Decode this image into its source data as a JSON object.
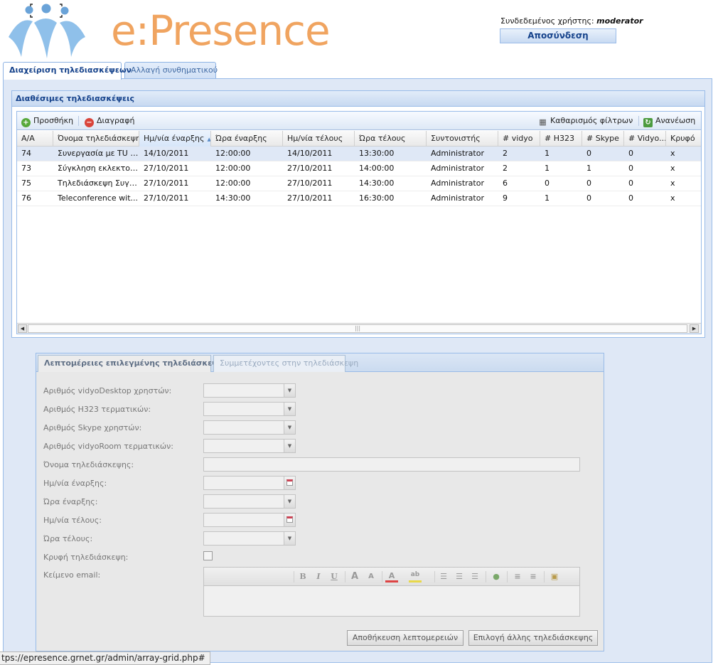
{
  "header": {
    "logo_text": "e:Presence",
    "user_label": "Συνδεδεμένος χρήστης:",
    "username": "moderator",
    "logout_label": "Αποσύνδεση"
  },
  "top_tabs": [
    {
      "label": "Διαχείριση τηλεδιασκέψεων",
      "active": true
    },
    {
      "label": "Αλλαγή συνθηματικού",
      "active": false
    }
  ],
  "grid": {
    "title": "Διαθέσιμες τηλεδιασκέψεις",
    "toolbar": {
      "add_label": "Προσθήκη",
      "delete_label": "Διαγραφή",
      "clear_filters_label": "Καθαρισμός φίλτρων",
      "refresh_label": "Ανανέωση"
    },
    "columns": [
      "Α/Α",
      "Όνομα τηλεδιάσκεψης",
      "Ημ/νία έναρξης",
      "Ώρα έναρξης",
      "Ημ/νία τέλους",
      "Ώρα τέλους",
      "Συντονιστής",
      "# vidyo",
      "# H323",
      "# Skype",
      "# Vidyo...",
      "Κρυφό"
    ],
    "sorted_column": "Ημ/νία έναρξης",
    "rows": [
      [
        "74",
        "Συνεργασία με TU B...",
        "14/10/2011",
        "12:00:00",
        "14/10/2011",
        "13:30:00",
        "Administrator",
        "2",
        "1",
        "0",
        "0",
        "x"
      ],
      [
        "73",
        "Σύγκληση εκλεκτορι...",
        "27/10/2011",
        "12:00:00",
        "27/10/2011",
        "14:00:00",
        "Administrator",
        "2",
        "1",
        "1",
        "0",
        "x"
      ],
      [
        "75",
        "Τηλεδιάσκεψη Συγκ...",
        "27/10/2011",
        "12:00:00",
        "27/10/2011",
        "14:30:00",
        "Administrator",
        "6",
        "0",
        "0",
        "0",
        "x"
      ],
      [
        "76",
        "Teleconference wit...",
        "27/10/2011",
        "14:30:00",
        "27/10/2011",
        "16:30:00",
        "Administrator",
        "9",
        "1",
        "0",
        "0",
        "x"
      ]
    ],
    "selected_row": 0
  },
  "details": {
    "tabs": [
      {
        "label": "Λεπτομέρειες επιλεγμένης τηλεδιάσκεψης",
        "active": true
      },
      {
        "label": "Συμμετέχοντες στην τηλεδιάσκεψη",
        "active": false
      }
    ],
    "fields": {
      "vidyo_desktop": "Αριθμός vidyoDesktop χρηστών:",
      "h323": "Αριθμός H323 τερματικών:",
      "skype": "Αριθμός Skype χρηστών:",
      "vidyo_room": "Αριθμός vidyoRoom τερματικών:",
      "name": "Όνομα τηλεδιάσκεψης:",
      "start_date": "Ημ/νία έναρξης:",
      "start_time": "Ώρα έναρξης:",
      "end_date": "Ημ/νία τέλους:",
      "end_time": "Ώρα τέλους:",
      "hidden": "Κρυφή τηλεδιάσκεψη:",
      "email_text": "Κείμενο email:"
    },
    "editor_buttons": {
      "bold": "B",
      "italic": "I",
      "underline": "U",
      "grow": "A",
      "shrink": "A",
      "color": "A",
      "highlight": "ab"
    },
    "save_label": "Αποθήκευση λεπτομερειών",
    "select_other_label": "Επιλογή άλλης τηλεδιάσκεψης"
  },
  "status_bar": {
    "url": "tps://epresence.grnet.gr/admin/array-grid.php#"
  },
  "colors": {
    "brand_orange": "#f0a460",
    "header_blue": "#15428b",
    "border_blue": "#99bbe8",
    "selected_row": "#dfe8f6"
  }
}
